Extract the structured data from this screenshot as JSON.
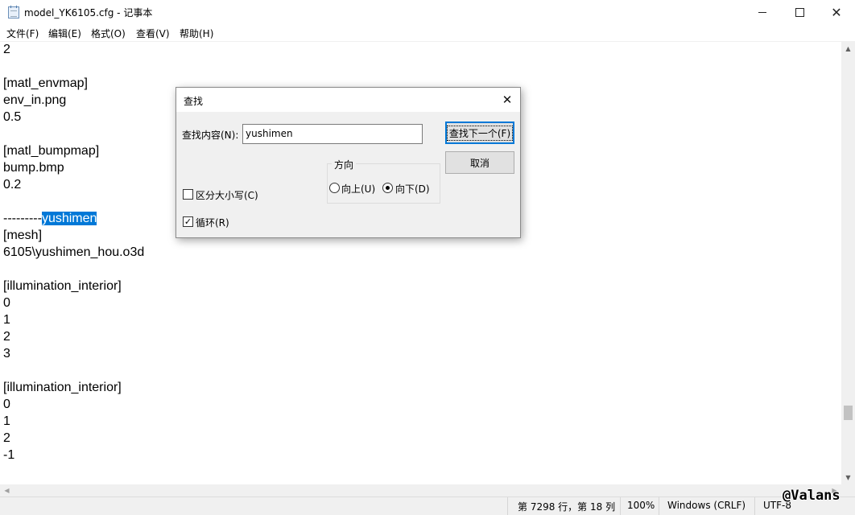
{
  "window": {
    "title": "model_YK6105.cfg - 记事本",
    "minimize_glyph": "",
    "maximize_glyph": "",
    "close_glyph": "✕"
  },
  "menu": [
    "文件(F)",
    "编辑(E)",
    "格式(O)",
    "查看(V)",
    "帮助(H)"
  ],
  "editor": {
    "lines": [
      "2",
      "",
      "[matl_envmap]",
      "env_in.png",
      "0.5",
      "",
      "[matl_bumpmap]",
      "bump.bmp",
      "0.2",
      "",
      "---------",
      "[mesh]",
      "6105\\yushimen_hou.o3d",
      "",
      "[illumination_interior]",
      "0",
      "1",
      "2",
      "3",
      "",
      "[illumination_interior]",
      "0",
      "1",
      "2",
      "-1"
    ],
    "highlighted_text": "yushimen"
  },
  "scrollbars": {
    "up": "▲",
    "down": "▼",
    "left": "◀",
    "right": "▶"
  },
  "statusbar": {
    "position": "第 7298 行，第 18 列",
    "zoom": "100%",
    "line_ending": "Windows (CRLF)",
    "encoding": "UTF-8"
  },
  "watermark": "@Valans",
  "find_dialog": {
    "title": "查找",
    "close_glyph": "✕",
    "find_label": "查找内容(N):",
    "find_value": "yushimen",
    "find_next_label": "查找下一个(F)",
    "cancel_label": "取消",
    "direction_label": "方向",
    "up_label": "向上(U)",
    "down_label": "向下(D)",
    "direction_selected": "down",
    "match_case_label": "区分大小写(C)",
    "match_case_checked": false,
    "wrap_label": "循环(R)",
    "wrap_checked": true,
    "check_glyph": "✓"
  }
}
